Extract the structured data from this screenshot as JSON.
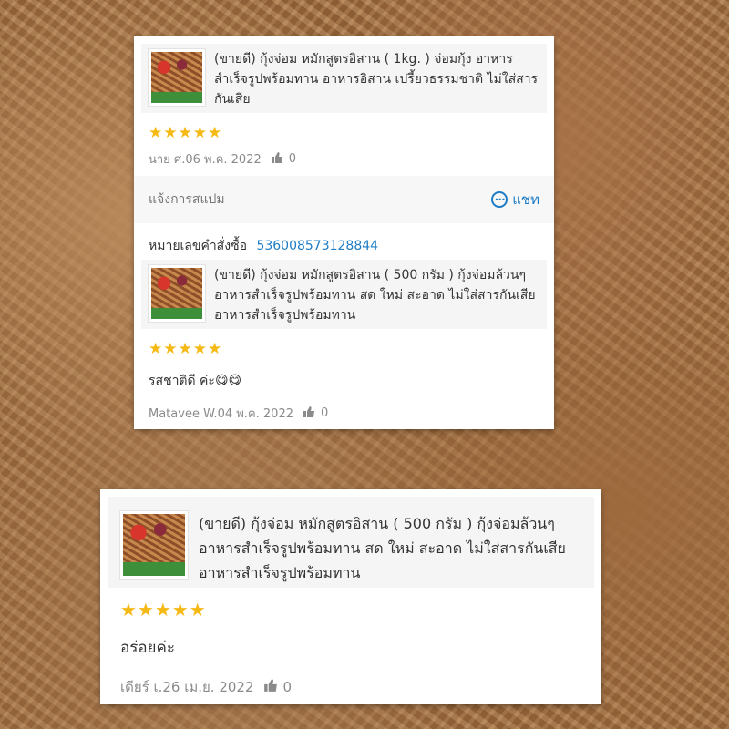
{
  "review1": {
    "product_title": "(ขายดี) กุ้งจ่อม หมักสูตรอิสาน ( 1kg. ) จ่อมกุ้ง อาหารสำเร็จรูปพร้อมทาน อาหารอิสาน เปรี้ยวธรรมชาติ ไม่ใส่สารกันเสีย",
    "stars": "★★★★★",
    "reviewer_date": "นาย ศ.06 พ.ค. 2022",
    "likes": "0"
  },
  "spam": {
    "report_label": "แจ้งการสแปม",
    "chat_label": "แชท",
    "chat_icon": "chat-bubble-icon"
  },
  "order": {
    "label": "หมายเลขคำสั่งซื้อ",
    "number": "536008573128844"
  },
  "review2": {
    "product_title": "(ขายดี) กุ้งจ่อม หมักสูตรอิสาน ( 500 กรัม ) กุ้งจ่อมล้วนๆ อาหารสำเร็จรูปพร้อมทาน สด ใหม่ สะอาด ไม่ใส่สารกันเสีย อาหารสำเร็จรูปพร้อมทาน",
    "stars": "★★★★★",
    "comment": "รสชาติดี ค่ะ😋😋",
    "reviewer_date": "Matavee W.04 พ.ค. 2022",
    "likes": "0"
  },
  "review3": {
    "product_title": "(ขายดี) กุ้งจ่อม หมักสูตรอิสาน ( 500 กรัม ) กุ้งจ่อมล้วนๆ อาหารสำเร็จรูปพร้อมทาน สด ใหม่ สะอาด ไม่ใส่สารกันเสีย อาหารสำเร็จรูปพร้อมทาน",
    "stars": "★★★★★",
    "comment": "อร่อยค่ะ",
    "reviewer_date": "เดียร์ เ.26 เม.ย. 2022",
    "likes": "0"
  },
  "colors": {
    "star": "#f5b915",
    "link": "#1f7cc4",
    "meta": "#8a8a8a"
  }
}
